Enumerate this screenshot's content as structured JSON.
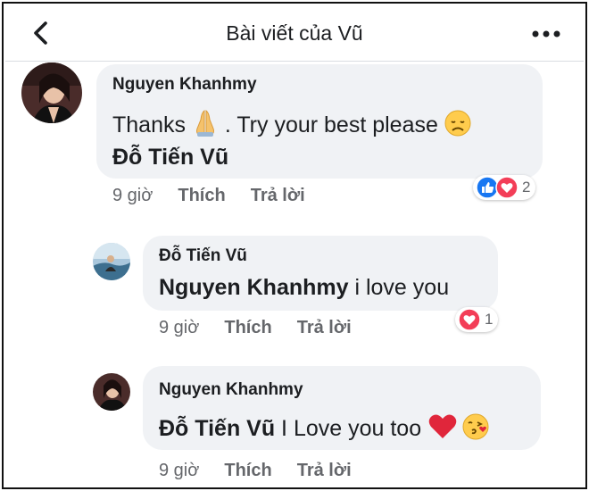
{
  "header": {
    "title": "Bài viết của Vũ",
    "back_icon": "chevron-left-icon",
    "more_icon": "more-horizontal-icon"
  },
  "comments": [
    {
      "author": "Nguyen Khanhmy",
      "text_before": "Thanks ",
      "emoji_1": "folded-hands-emoji",
      "text_middle": " . Try your best please ",
      "emoji_2": "disappointed-face-emoji",
      "mention": "Đỗ Tiến Vũ",
      "time": "9 giờ",
      "like_label": "Thích",
      "reply_label": "Trả lời",
      "reactions": [
        "like",
        "love"
      ],
      "reaction_count": "2"
    },
    {
      "author": "Đỗ Tiến Vũ",
      "mention": "Nguyen Khanhmy",
      "text": " i love you",
      "time": "9 giờ",
      "like_label": "Thích",
      "reply_label": "Trả lời",
      "reactions": [
        "love"
      ],
      "reaction_count": "1"
    },
    {
      "author": "Nguyen Khanhmy",
      "mention": "Đỗ Tiến Vũ",
      "text": " I Love you too ",
      "emoji_1": "red-heart-emoji",
      "emoji_2": "face-blowing-kiss-emoji",
      "time": "9 giờ",
      "like_label": "Thích",
      "reply_label": "Trả lời"
    }
  ],
  "colors": {
    "bubble": "#f0f2f5",
    "meta_text": "#65676b",
    "like_blue": "#1877f2",
    "love_red": "#f33e58"
  }
}
